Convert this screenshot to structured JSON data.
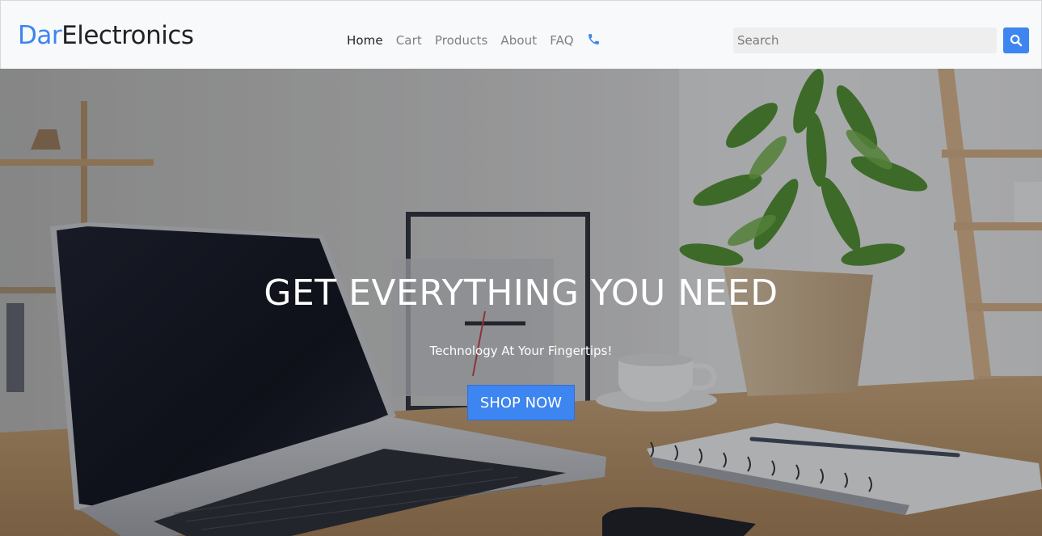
{
  "brand": {
    "accent": "Dar",
    "rest": "Electronics"
  },
  "nav": {
    "items": [
      {
        "label": "Home",
        "active": true
      },
      {
        "label": "Cart"
      },
      {
        "label": "Products"
      },
      {
        "label": "About"
      },
      {
        "label": "FAQ"
      }
    ],
    "phone_icon": "phone-icon"
  },
  "search": {
    "placeholder": "Search",
    "value": "",
    "button_icon": "search-icon"
  },
  "hero": {
    "title": "GET EVERYTHING YOU NEED",
    "subtitle": "Technology At Your Fingertips!",
    "cta": "SHOP NOW",
    "image": "desk with laptop, plant, coffee cup and notebook"
  },
  "colors": {
    "accent": "#3d85f0",
    "navbar_bg": "#f8f9fb",
    "text_dark": "#222222",
    "nav_muted": "#808080"
  }
}
